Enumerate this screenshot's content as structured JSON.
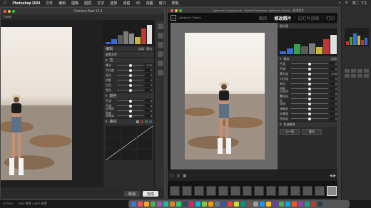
{
  "menubar": {
    "app_name": "Photoshop 2024",
    "items": [
      "文件",
      "编辑",
      "图像",
      "图层",
      "文字",
      "选择",
      "滤镜",
      "3D",
      "视图",
      "窗口",
      "帮助"
    ],
    "time": "周二 下午"
  },
  "acr": {
    "title": "Camera Raw 16.1",
    "file_label": "f.arw",
    "panel": {
      "edit_label": "编辑",
      "auto_label": "自动",
      "bw_label": "黑白",
      "profile_label": "配置文件",
      "basic_section": "亮",
      "basic_sliders": [
        {
          "label": "曝光",
          "value": "0.00"
        },
        {
          "label": "对比度",
          "value": "0"
        },
        {
          "label": "高光",
          "value": "0"
        },
        {
          "label": "阴影",
          "value": "0"
        },
        {
          "label": "白色",
          "value": "0"
        },
        {
          "label": "黑色",
          "value": "0"
        }
      ],
      "color_section": "颜色",
      "color_sliders": [
        {
          "label": "色温",
          "value": "0"
        },
        {
          "label": "色调",
          "value": "0"
        },
        {
          "label": "自然饱和度",
          "value": "0"
        },
        {
          "label": "饱和度",
          "value": "0"
        }
      ],
      "curve_section": "曲线"
    },
    "cancel_label": "取消",
    "done_label": "完成"
  },
  "lightroom": {
    "title": "Lightroom Catalog.lrcat - Adobe Photoshop Lightroom Classic - 修改照片",
    "brand": "Lightroom Classic",
    "modules": [
      "图库",
      "修改照片",
      "幻灯片放映",
      "打印"
    ],
    "active_module": "修改照片",
    "panel": {
      "histogram_label": "直方图",
      "basic_label": "基本",
      "tone_label": "色调",
      "auto_label": "自动",
      "presence_label": "偏好",
      "sliders": [
        {
          "label": "色温",
          "value": "0"
        },
        {
          "label": "色调",
          "value": "0"
        },
        {
          "label": "曝光度",
          "value": "0.00"
        },
        {
          "label": "对比度",
          "value": "0"
        },
        {
          "label": "高光",
          "value": "0"
        },
        {
          "label": "阴影",
          "value": "0"
        },
        {
          "label": "白色色阶",
          "value": "0"
        },
        {
          "label": "黑色色阶",
          "value": "0"
        },
        {
          "label": "纹理",
          "value": "0"
        },
        {
          "label": "清晰度",
          "value": "0"
        },
        {
          "label": "去朦胧",
          "value": "0"
        },
        {
          "label": "饱和度",
          "value": "0"
        }
      ],
      "curve_label": "色调曲线",
      "prev_label": "上一张",
      "reset_label": "复位"
    },
    "filmstrip_count": 14
  },
  "colors": {
    "accent": "#e8e8e8",
    "ps_bg": "#3a3a3a",
    "lr_bg": "#1f1f1f",
    "hist_blue": "#3a6bd4",
    "hist_red": "#c03535",
    "hist_green": "#3aa14a",
    "hist_yellow": "#c9b53a"
  },
  "statusbar": {
    "zoom": "33.33%",
    "info": "3000 像素 x 4500 像素"
  }
}
